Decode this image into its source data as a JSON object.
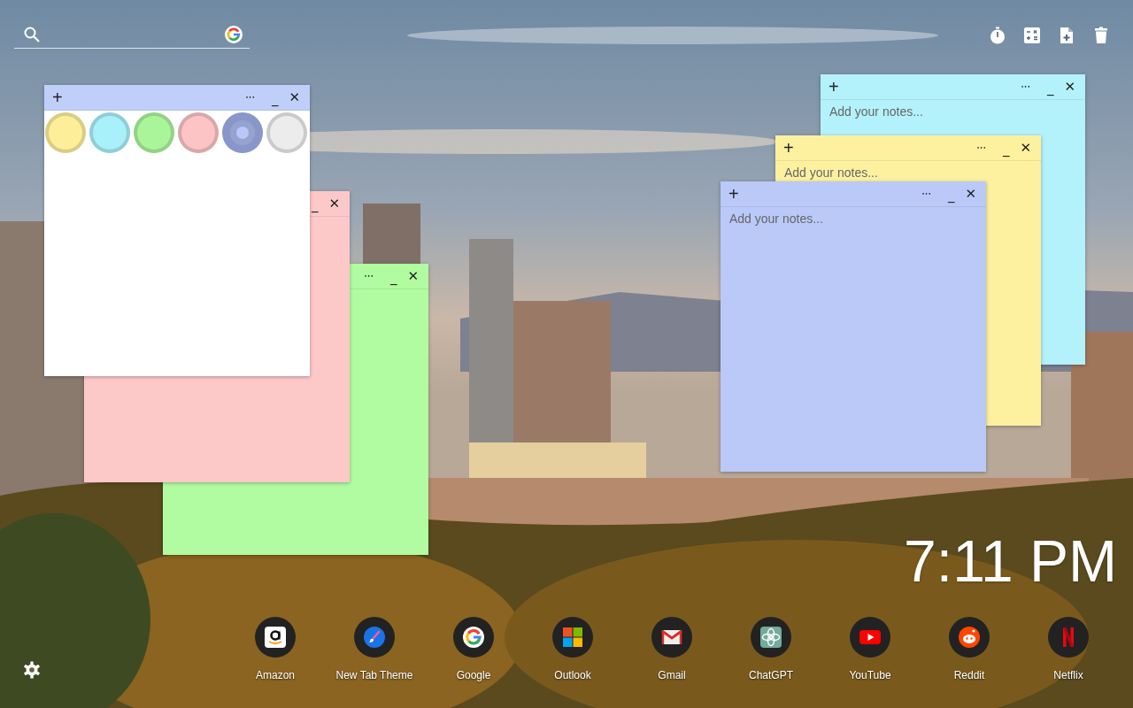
{
  "notes": [
    {
      "kind": "note",
      "color": "#b3f2fb",
      "controls": [
        {
          "kind": "add",
          "label": "+"
        },
        {
          "kind": "more",
          "label": "•••"
        },
        {
          "kind": "minimize",
          "label": "_"
        },
        {
          "kind": "close",
          "label": "✕"
        }
      ],
      "placeholder": "Add your notes..."
    },
    {
      "kind": "note",
      "color": "#fdf1a0",
      "controls": [
        {
          "kind": "add",
          "label": "+"
        },
        {
          "kind": "more",
          "label": "•••"
        },
        {
          "kind": "minimize",
          "label": "_"
        },
        {
          "kind": "close",
          "label": "✕"
        }
      ],
      "placeholder": "Add your notes..."
    },
    {
      "kind": "note",
      "color": "#bbc9f8",
      "controls": [
        {
          "kind": "add",
          "label": "+"
        },
        {
          "kind": "more",
          "label": "•••"
        },
        {
          "kind": "minimize",
          "label": "_"
        },
        {
          "kind": "close",
          "label": "✕"
        }
      ],
      "placeholder": "Add your notes..."
    },
    {
      "kind": "note",
      "color": "#b1fca1",
      "controls": [
        {
          "kind": "more",
          "label": "•••"
        },
        {
          "kind": "minimize",
          "label": "_"
        },
        {
          "kind": "close",
          "label": "✕"
        }
      ]
    },
    {
      "kind": "note",
      "color": "#fdc8c8",
      "controls": [
        {
          "kind": "minimize",
          "label": "_"
        },
        {
          "kind": "close",
          "label": "✕"
        }
      ]
    },
    {
      "kind": "palette",
      "color": "#c0cffa",
      "controls": [
        {
          "kind": "add",
          "label": "+"
        },
        {
          "kind": "more",
          "label": "•••"
        },
        {
          "kind": "minimize",
          "label": "_"
        },
        {
          "kind": "close",
          "label": "✕"
        }
      ],
      "swatches": [
        {
          "color": "#fdef9a",
          "selected": false
        },
        {
          "color": "#a8f0fa",
          "selected": false
        },
        {
          "color": "#aaf59a",
          "selected": false
        },
        {
          "color": "#fcc4c4",
          "selected": false
        },
        {
          "color": "#b9c8f6",
          "selected": true
        },
        {
          "color": "#ececec",
          "selected": false
        }
      ]
    }
  ],
  "clock": {
    "time": "7:11 PM"
  },
  "shortcuts": [
    {
      "kind": "amazon",
      "label": "Amazon"
    },
    {
      "kind": "brush",
      "label": "New Tab Theme"
    },
    {
      "kind": "google",
      "label": "Google"
    },
    {
      "kind": "microsoft",
      "label": "Outlook"
    },
    {
      "kind": "gmail",
      "label": "Gmail"
    },
    {
      "kind": "chatgpt",
      "label": "ChatGPT"
    },
    {
      "kind": "youtube",
      "label": "YouTube"
    },
    {
      "kind": "reddit",
      "label": "Reddit"
    },
    {
      "kind": "netflix",
      "label": "Netflix"
    }
  ]
}
